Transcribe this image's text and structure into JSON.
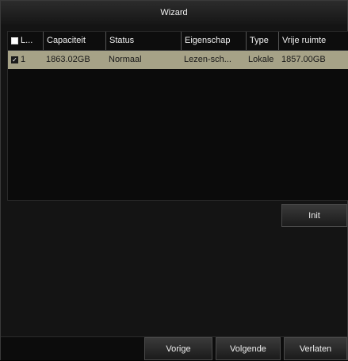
{
  "window": {
    "title": "Wizard"
  },
  "table": {
    "columns": {
      "label": "L...",
      "capacity": "Capaciteit",
      "status": "Status",
      "property": "Eigenschap",
      "type": "Type",
      "free_space": "Vrije ruimte"
    },
    "rows": [
      {
        "label": "1",
        "capacity": "1863.02GB",
        "status": "Normaal",
        "property": "Lezen-sch...",
        "type": "Lokale",
        "free_space": "1857.00GB",
        "checked": true
      }
    ]
  },
  "buttons": {
    "init": "Init",
    "previous": "Vorige",
    "next": "Volgende",
    "exit": "Verlaten"
  },
  "colors": {
    "selected_row": "#a6a287",
    "background": "#141414"
  }
}
